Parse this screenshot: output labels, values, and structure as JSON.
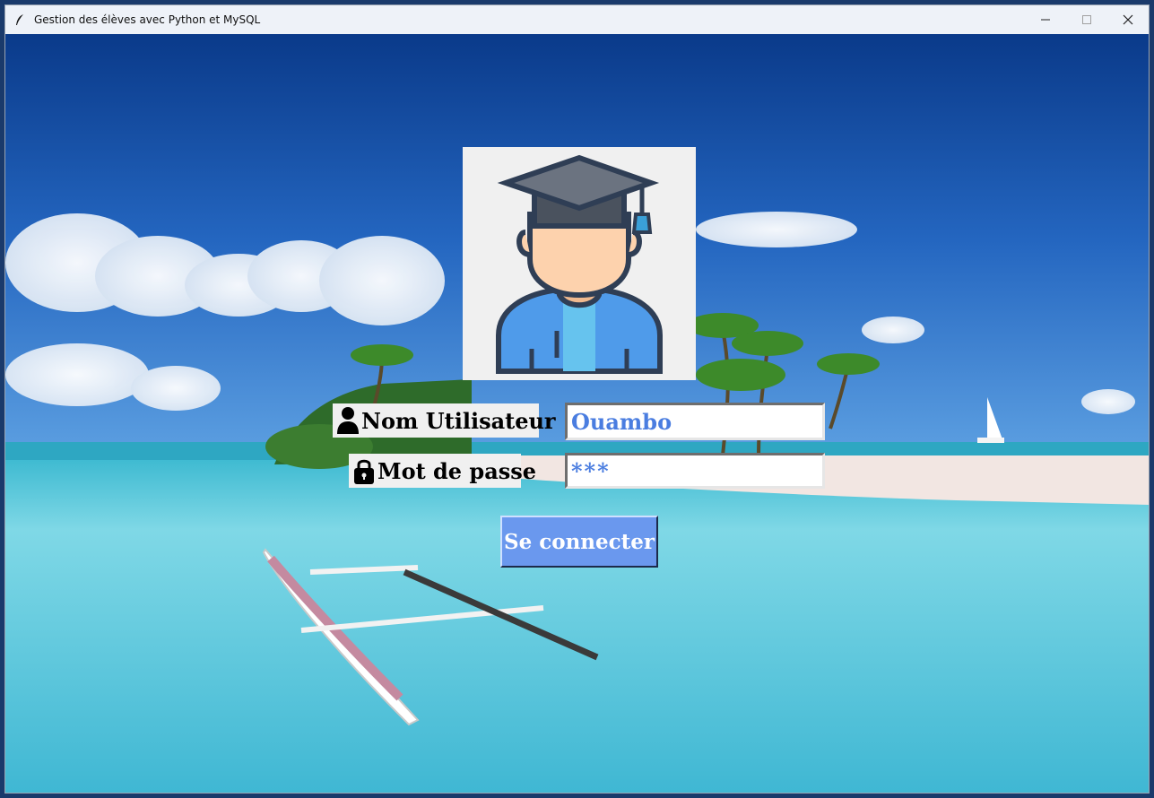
{
  "window": {
    "title": "Gestion des élèves avec Python et MySQL",
    "app_icon": "feather-icon",
    "controls": {
      "minimize": "—",
      "maximize": "☐",
      "close": "✕"
    }
  },
  "background": {
    "description_icon": "beach-landscape",
    "colors": {
      "sky_top": "#0a3a8a",
      "sky_mid": "#2a6fc6",
      "sea": "#5ec9dd",
      "sand": "#f2e6e2"
    }
  },
  "login": {
    "avatar_icon": "graduate-student-icon",
    "username_label": "Nom Utilisateur",
    "username_icon": "user-icon",
    "username_value": "Ouambo",
    "password_label": "Mot de passe",
    "password_icon": "lock-icon",
    "password_value": "***",
    "submit_label": "Se connecter",
    "colors": {
      "button_bg": "#6a98ee",
      "input_text": "#4a7de0",
      "label_bg": "#f0f0f0"
    }
  }
}
